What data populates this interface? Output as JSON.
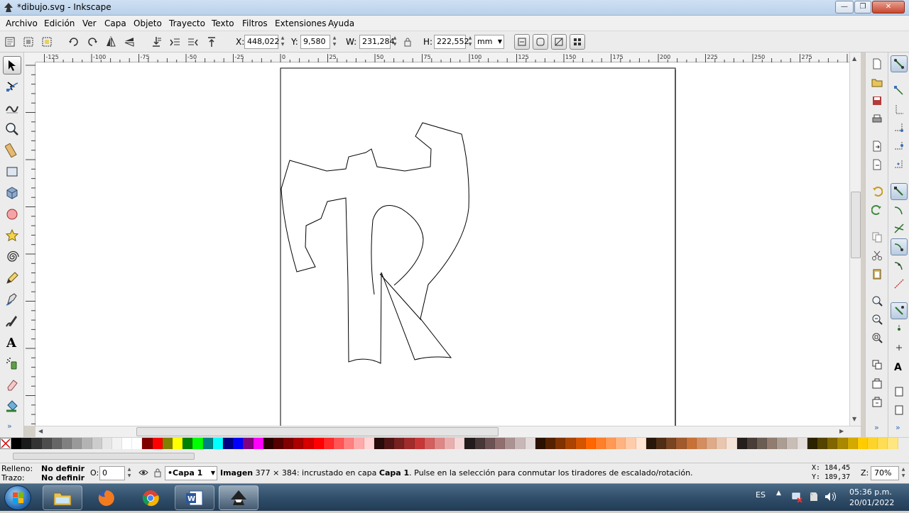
{
  "window": {
    "title": "*dibujo.svg - Inkscape",
    "controls": {
      "minimize": "—",
      "maximize": "❐",
      "close": "✕"
    }
  },
  "menu": [
    "Archivo",
    "Edición",
    "Ver",
    "Capa",
    "Objeto",
    "Trayecto",
    "Texto",
    "Filtros",
    "Extensiones",
    "Ayuda"
  ],
  "controls": {
    "x_label": "X:",
    "x_value": "448,022",
    "y_label": "Y:",
    "y_value": "9,580",
    "w_label": "W:",
    "w_value": "231,284",
    "h_label": "H:",
    "h_value": "222,552",
    "unit": "mm"
  },
  "ruler_ticks": [
    "-125",
    "-100",
    "-75",
    "-50",
    "-25",
    "0",
    "25",
    "50",
    "75",
    "100",
    "125",
    "150",
    "175",
    "200",
    "225",
    "250",
    "275"
  ],
  "palette": [
    "#000000",
    "#1a1a1a",
    "#333333",
    "#4d4d4d",
    "#666666",
    "#808080",
    "#999999",
    "#b3b3b3",
    "#cccccc",
    "#e6e6e6",
    "#f2f2f2",
    "#ffffff",
    "#ffffff",
    "#800000",
    "#ff0000",
    "#808000",
    "#ffff00",
    "#008000",
    "#00ff00",
    "#008080",
    "#00ffff",
    "#000080",
    "#0000ff",
    "#800080",
    "#ff00ff",
    "#2b0000",
    "#550000",
    "#800000",
    "#aa0000",
    "#d40000",
    "#ff0000",
    "#ff2a2a",
    "#ff5555",
    "#ff8080",
    "#ffaaaa",
    "#ffd5d5",
    "#280b0b",
    "#501616",
    "#782121",
    "#a02c2c",
    "#c83737",
    "#d35f5f",
    "#de8787",
    "#e9afaf",
    "#f4d7d7",
    "#241c1c",
    "#483737",
    "#6c5353",
    "#916f6f",
    "#ac9393",
    "#c8b7b7",
    "#e3dbdb",
    "#2b1100",
    "#552200",
    "#803300",
    "#aa4400",
    "#d45500",
    "#ff6600",
    "#ff7f2a",
    "#ff9955",
    "#ffb380",
    "#ffccaa",
    "#ffe6d5",
    "#28170b",
    "#502d16",
    "#784421",
    "#a05a2c",
    "#c87137",
    "#d38d5f",
    "#deaa87",
    "#e9c6af",
    "#f4e3d7",
    "#241f1c",
    "#483e37",
    "#6c5d53",
    "#917c6f",
    "#ac9d93",
    "#c8beb7",
    "#e3dedb",
    "#2b2200",
    "#554400",
    "#806600",
    "#aa8800",
    "#d4aa00",
    "#ffcc00",
    "#ffd42a",
    "#ffdd55",
    "#ffe680"
  ],
  "status": {
    "fill_label": "Relleno:",
    "fill_value": "No definir",
    "stroke_label": "Trazo:",
    "stroke_value": "No definir",
    "opacity_label": "O:",
    "opacity_value": "0",
    "layer": "•Capa 1",
    "msg_bold1": "Imagen",
    "msg_1": " 377 × 384: incrustado en capa ",
    "msg_bold2": "Capa 1",
    "msg_2": ". Pulse en la selección para conmutar los tiradores de escalado/rotación.",
    "cursor_x": "X: 184,45",
    "cursor_y": "Y: 189,37",
    "zoom_label": "Z:",
    "zoom_value": "70%"
  },
  "taskbar": {
    "language": "ES",
    "time": "05:36 p.m.",
    "date": "20/01/2022"
  }
}
